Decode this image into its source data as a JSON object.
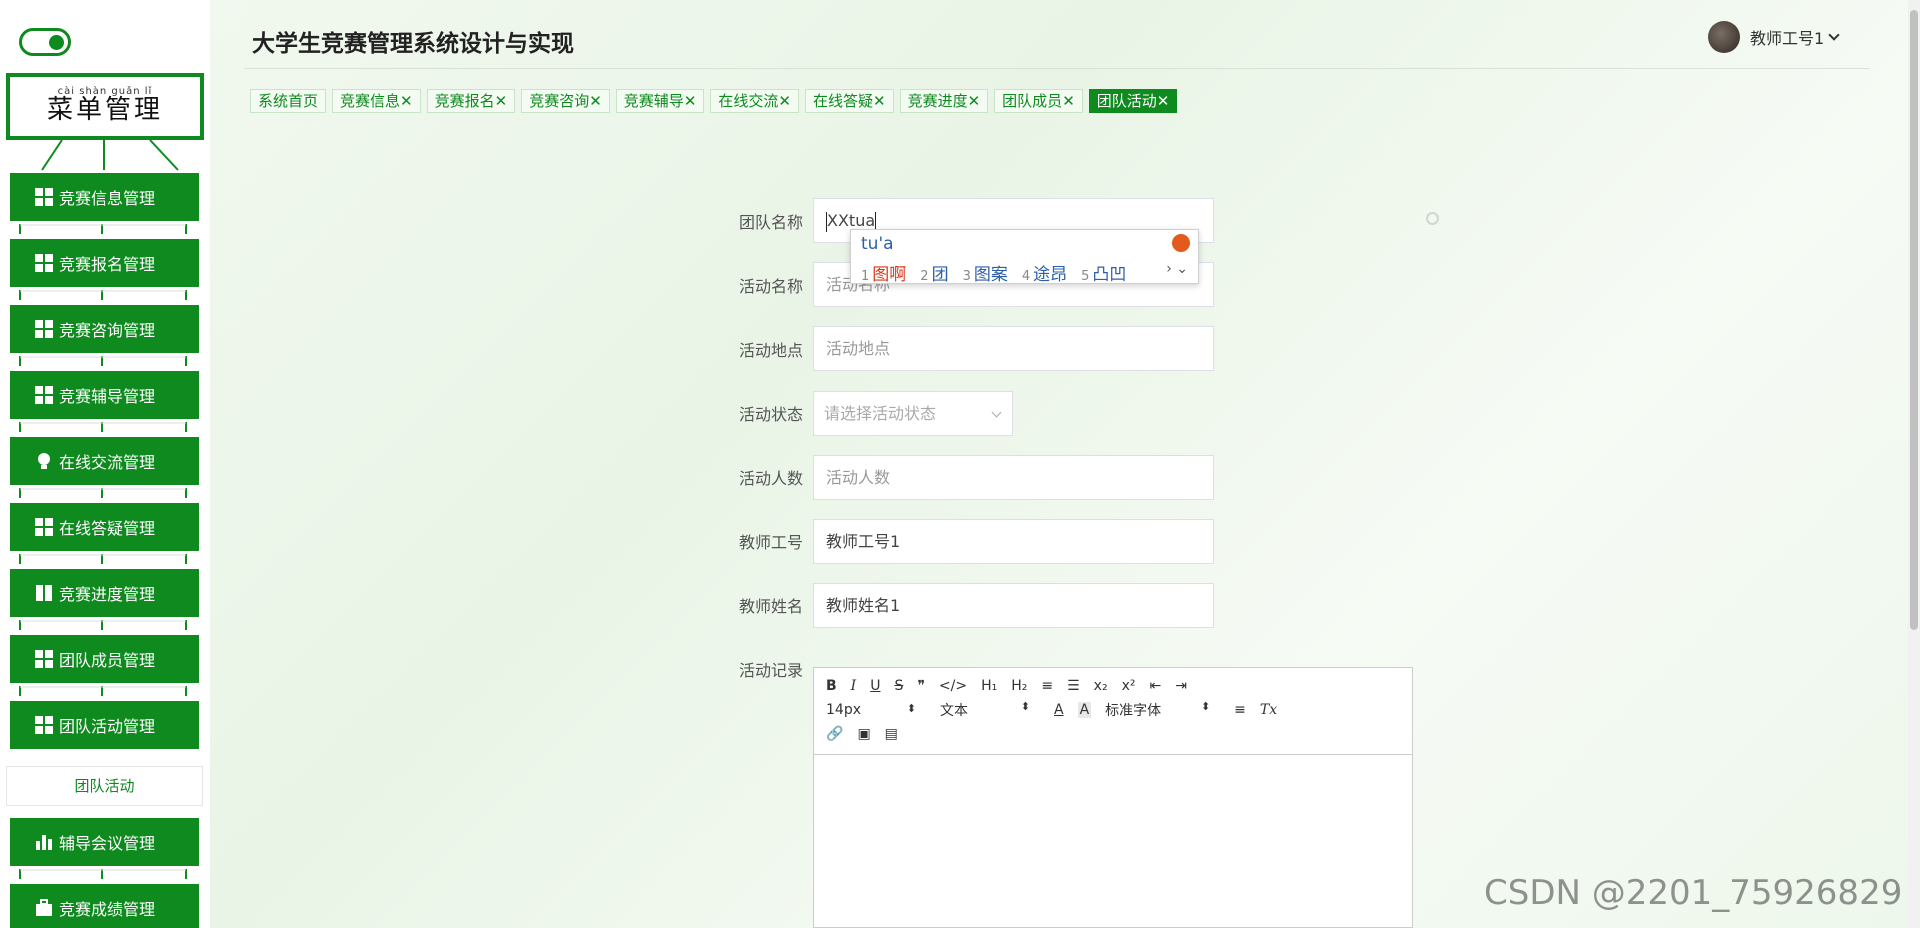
{
  "sidebar": {
    "menu_pinyin": "cài shàn guǎn  lǐ",
    "menu_title": "菜单管理",
    "items": [
      {
        "label": "竞赛信息管理",
        "icon": "grid-icon"
      },
      {
        "label": "竞赛报名管理",
        "icon": "grid-icon"
      },
      {
        "label": "竞赛咨询管理",
        "icon": "grid-icon"
      },
      {
        "label": "竞赛辅导管理",
        "icon": "grid-icon"
      },
      {
        "label": "在线交流管理",
        "icon": "bulb-icon"
      },
      {
        "label": "在线答疑管理",
        "icon": "grid-icon"
      },
      {
        "label": "竞赛进度管理",
        "icon": "book-icon"
      },
      {
        "label": "团队成员管理",
        "icon": "grid-icon"
      },
      {
        "label": "团队活动管理",
        "icon": "grid-icon"
      },
      {
        "label": "辅导会议管理",
        "icon": "bar-chart-icon"
      },
      {
        "label": "竞赛成绩管理",
        "icon": "briefcase-icon"
      }
    ],
    "sub_item": "团队活动"
  },
  "header": {
    "title": "大学生竞赛管理系统设计与实现",
    "user_name": "教师工号1"
  },
  "tabs": [
    {
      "label": "系统首页",
      "closable": false
    },
    {
      "label": "竞赛信息",
      "closable": true
    },
    {
      "label": "竞赛报名",
      "closable": true
    },
    {
      "label": "竞赛咨询",
      "closable": true
    },
    {
      "label": "竞赛辅导",
      "closable": true
    },
    {
      "label": "在线交流",
      "closable": true
    },
    {
      "label": "在线答疑",
      "closable": true
    },
    {
      "label": "竞赛进度",
      "closable": true
    },
    {
      "label": "团队成员",
      "closable": true
    },
    {
      "label": "团队活动",
      "closable": true,
      "active": true
    }
  ],
  "tab_close_glyph": "✕",
  "form": {
    "team_name_label": "团队名称",
    "team_name_value": "XXtua",
    "activity_name_label": "活动名称",
    "activity_name_placeholder": "活动名称",
    "location_label": "活动地点",
    "location_placeholder": "活动地点",
    "status_label": "活动状态",
    "status_placeholder": "请选择活动状态",
    "count_label": "活动人数",
    "count_placeholder": "活动人数",
    "teacher_id_label": "教师工号",
    "teacher_id_value": "教师工号1",
    "teacher_name_label": "教师姓名",
    "teacher_name_value": "教师姓名1",
    "record_label": "活动记录"
  },
  "ime": {
    "composition": "tu'a",
    "candidates": [
      {
        "num": "1",
        "text": "图啊"
      },
      {
        "num": "2",
        "text": "团"
      },
      {
        "num": "3",
        "text": "图案"
      },
      {
        "num": "4",
        "text": "途昂"
      },
      {
        "num": "5",
        "text": "凸凹"
      }
    ],
    "nav": "› ⌄"
  },
  "editor": {
    "row1": [
      "B",
      "I",
      "U",
      "S",
      "❞",
      "</>",
      "H₁",
      "H₂",
      "≡",
      "☰",
      "x₂",
      "x²",
      "⇤",
      "⇥"
    ],
    "font_size": "14px",
    "paragraph": "文本",
    "color_btn": "A",
    "bg_btn": "A",
    "font_family": "标准字体",
    "align_btn": "≡",
    "clear_btn": "Tx",
    "row3": [
      "🔗",
      "▣",
      "▤"
    ]
  },
  "watermark": "CSDN @2201_75926829",
  "colors": {
    "primary": "#0e8a1f",
    "tab_bg": "#f4fbf3",
    "ime_candidate": "#2c5fa8"
  }
}
